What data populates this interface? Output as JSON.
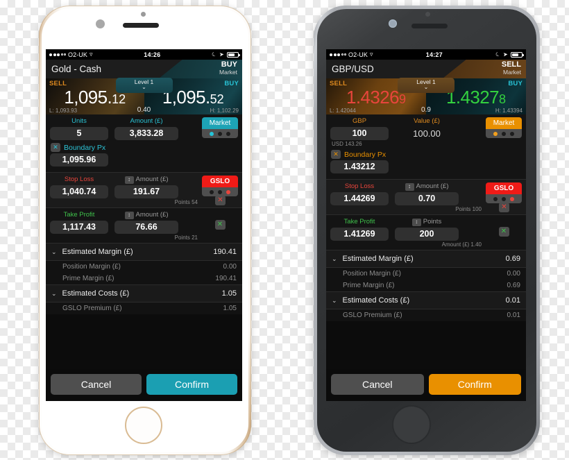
{
  "phones": [
    {
      "id": "white-gold-iphone",
      "accent": "#1da3b5",
      "statusbar": {
        "carrier": "O2-UK",
        "time": "14:26",
        "wifi_icon": "wifi-icon",
        "moon_icon": "do-not-disturb-icon",
        "location_icon": "location-arrow-icon",
        "battery_icon": "battery-icon"
      },
      "titlebar": {
        "instrument": "Gold - Cash",
        "action": "BUY",
        "action_sub": "Market"
      },
      "price": {
        "sell_label": "SELL",
        "buy_label": "BUY",
        "sell_main": "1,095.",
        "sell_dec": "12",
        "buy_main": "1,095.",
        "buy_dec": "52",
        "sell_color": "#ffffff",
        "buy_color": "#ffffff",
        "low": "L: 1,093.93",
        "high": "H: 1,102.29",
        "spread": "0.40",
        "level": "Level 1"
      },
      "order": {
        "qty_label": "Units",
        "qty_value": "5",
        "amount_label": "Amount (£)",
        "amount_value": "3,833.28",
        "amount_is_box": true,
        "sub_note": "",
        "market_label": "Market",
        "market_dot_index": 0
      },
      "boundary": {
        "checkbox_glyph": "✕",
        "label": "Boundary Px",
        "value": "1,095.96"
      },
      "stoploss": {
        "label": "Stop Loss",
        "value": "1,040.74",
        "second_label": "Amount (£)",
        "second_value": "191.67",
        "gslo_label": "GSLO",
        "gslo_dot_index": 2,
        "points": "Points 54",
        "toggle_glyph": "✕"
      },
      "takeprofit": {
        "label": "Take Profit",
        "value": "1,117.43",
        "second_label": "Amount (£)",
        "second_value": "76.66",
        "points": "Points 21",
        "toggle_glyph": "✕"
      },
      "margin": {
        "title": "Estimated Margin (£)",
        "value": "190.41",
        "rows": [
          {
            "label": "Position Margin (£)",
            "value": "0.00"
          },
          {
            "label": "Prime Margin (£)",
            "value": "190.41"
          }
        ]
      },
      "costs": {
        "title": "Estimated Costs (£)",
        "value": "1.05",
        "rows": [
          {
            "label": "GSLO Premium (£)",
            "value": "1.05"
          }
        ]
      },
      "footer": {
        "cancel": "Cancel",
        "confirm": "Confirm"
      }
    },
    {
      "id": "space-grey-iphone",
      "accent": "#e99000",
      "statusbar": {
        "carrier": "O2-UK",
        "time": "14:27",
        "wifi_icon": "wifi-icon",
        "moon_icon": "do-not-disturb-icon",
        "location_icon": "location-arrow-icon",
        "battery_icon": "battery-icon"
      },
      "titlebar": {
        "instrument": "GBP/USD",
        "action": "SELL",
        "action_sub": "Market"
      },
      "price": {
        "sell_label": "SELL",
        "buy_label": "BUY",
        "sell_main": "1.4326",
        "sell_dec": "9",
        "buy_main": "1.4327",
        "buy_dec": "8",
        "sell_color": "#e8453c",
        "buy_color": "#33d13f",
        "low": "L: 1.42044",
        "high": "H: 1.43394",
        "spread": "0.9",
        "level": "Level 1"
      },
      "order": {
        "qty_label": "GBP",
        "qty_value": "100",
        "amount_label": "Value (£)",
        "amount_value": "100.00",
        "amount_is_box": false,
        "sub_note": "USD 143.26",
        "market_label": "Market",
        "market_dot_index": 0
      },
      "boundary": {
        "checkbox_glyph": "✕",
        "label": "Boundary Px",
        "value": "1.43212"
      },
      "stoploss": {
        "label": "Stop Loss",
        "value": "1.44269",
        "second_label": "Amount (£)",
        "second_value": "0.70",
        "gslo_label": "GSLO",
        "gslo_dot_index": 2,
        "points": "Points 100",
        "toggle_glyph": "✕"
      },
      "takeprofit": {
        "label": "Take Profit",
        "value": "1.41269",
        "second_label": "Points",
        "second_value": "200",
        "points": "Amount (£) 1.40",
        "toggle_glyph": "✕"
      },
      "margin": {
        "title": "Estimated Margin (£)",
        "value": "0.69",
        "rows": [
          {
            "label": "Position Margin (£)",
            "value": "0.00"
          },
          {
            "label": "Prime Margin (£)",
            "value": "0.69"
          }
        ]
      },
      "costs": {
        "title": "Estimated Costs (£)",
        "value": "0.01",
        "rows": [
          {
            "label": "GSLO Premium (£)",
            "value": "0.01"
          }
        ]
      },
      "footer": {
        "cancel": "Cancel",
        "confirm": "Confirm"
      }
    }
  ]
}
